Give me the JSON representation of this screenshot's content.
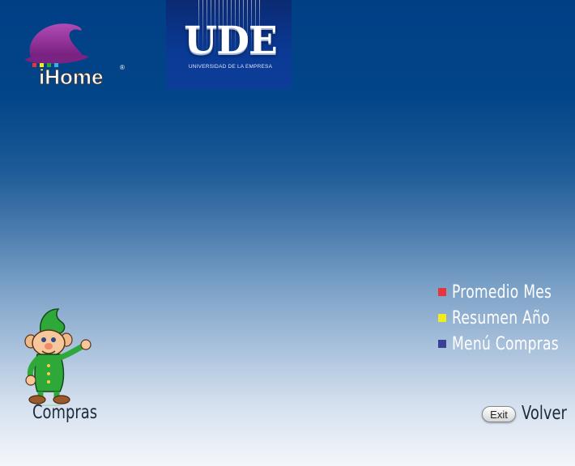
{
  "logos": {
    "ihome": {
      "text": "iHome",
      "registered": "®",
      "icon": "wizard-hat-icon"
    },
    "ude": {
      "text": "UDE",
      "subtitle": "UNIVERSIDAD DE LA EMPRESA"
    }
  },
  "menu": {
    "items": [
      {
        "label": "Promedio Mes",
        "bullet_color": "#e8343b"
      },
      {
        "label": "Resumen Año",
        "bullet_color": "#f2ec1a"
      },
      {
        "label": "Menú Compras",
        "bullet_color": "#3a3f97"
      }
    ]
  },
  "section": {
    "label": "Compras",
    "mascot": "dwarf-mascot-icon"
  },
  "footer": {
    "exit_label": "Exit",
    "back_label": "Volver"
  },
  "colors": {
    "background_top": "#013f85",
    "background_bottom": "#f4f7fb",
    "hat_purple": "#8e2a92",
    "dwarf_green": "#2fa83a"
  }
}
